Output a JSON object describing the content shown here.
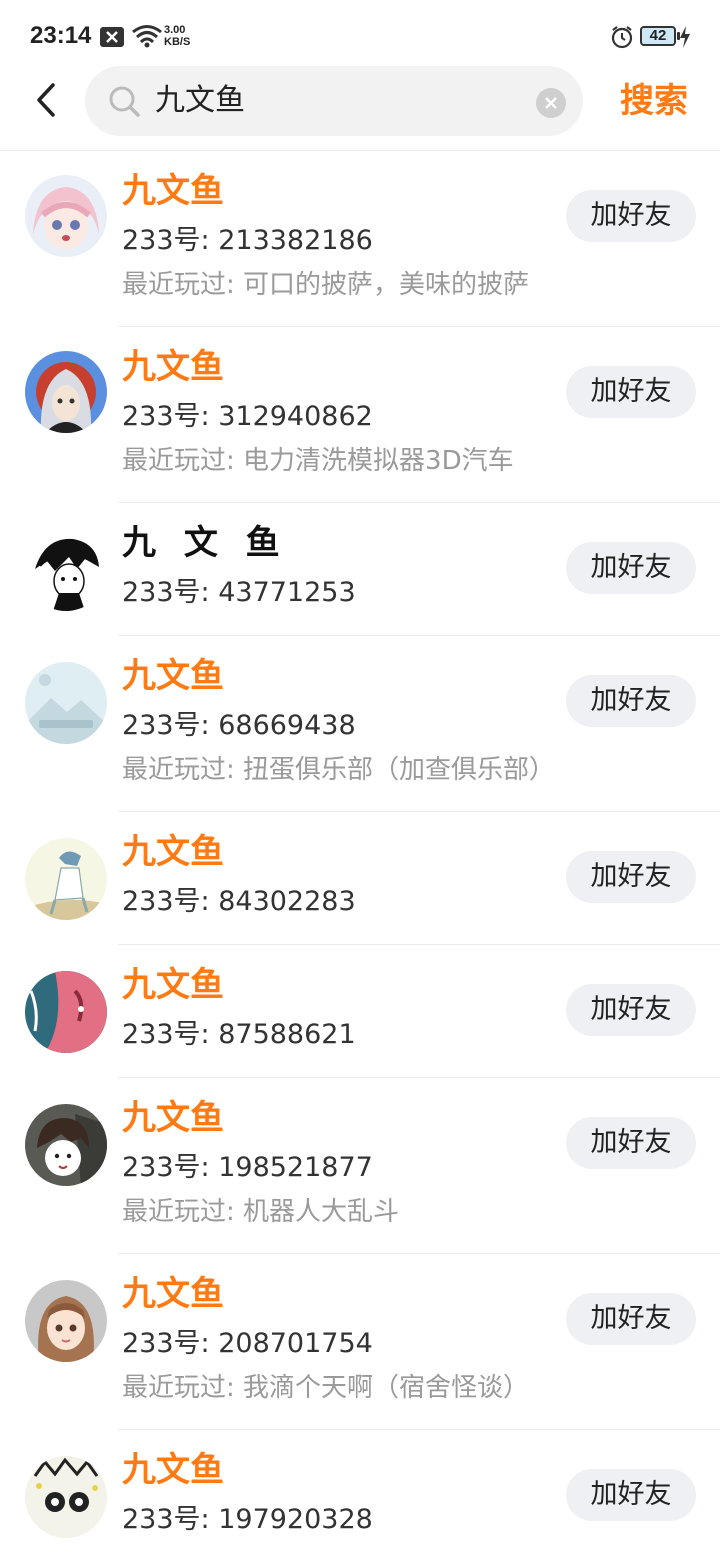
{
  "status_bar": {
    "time": "23:14",
    "net_speed_value": "3.00",
    "net_speed_unit": "KB/S",
    "battery": "42"
  },
  "search": {
    "query": "九文鱼",
    "submit_label": "搜索"
  },
  "colors": {
    "accent": "#ff7a12",
    "add_button_bg": "#eef0f3",
    "secondary_text": "#9a9a9a"
  },
  "results": [
    {
      "name": "九文鱼",
      "id_text": "233号: 213382186",
      "recent": "最近玩过: 可口的披萨，美味的披萨",
      "add_label": "加好友"
    },
    {
      "name": "九文鱼",
      "id_text": "233号: 312940862",
      "recent": "最近玩过: 电力清洗模拟器3D汽车",
      "add_label": "加好友"
    },
    {
      "name": "九 文 鱼",
      "id_text": "233号: 43771253",
      "add_label": "加好友"
    },
    {
      "name": "九文鱼",
      "id_text": "233号: 68669438",
      "recent": "最近玩过: 扭蛋俱乐部（加查俱乐部）",
      "add_label": "加好友"
    },
    {
      "name": "九文鱼",
      "id_text": "233号: 84302283",
      "add_label": "加好友"
    },
    {
      "name": "九文鱼",
      "id_text": "233号: 87588621",
      "add_label": "加好友"
    },
    {
      "name": "九文鱼",
      "id_text": "233号: 198521877",
      "recent": "最近玩过: 机器人大乱斗",
      "add_label": "加好友"
    },
    {
      "name": "九文鱼",
      "id_text": "233号: 208701754",
      "recent": "最近玩过: 我滴个天啊（宿舍怪谈）",
      "add_label": "加好友"
    },
    {
      "name": "九文鱼",
      "id_text": "233号: 197920328",
      "add_label": "加好友"
    }
  ]
}
